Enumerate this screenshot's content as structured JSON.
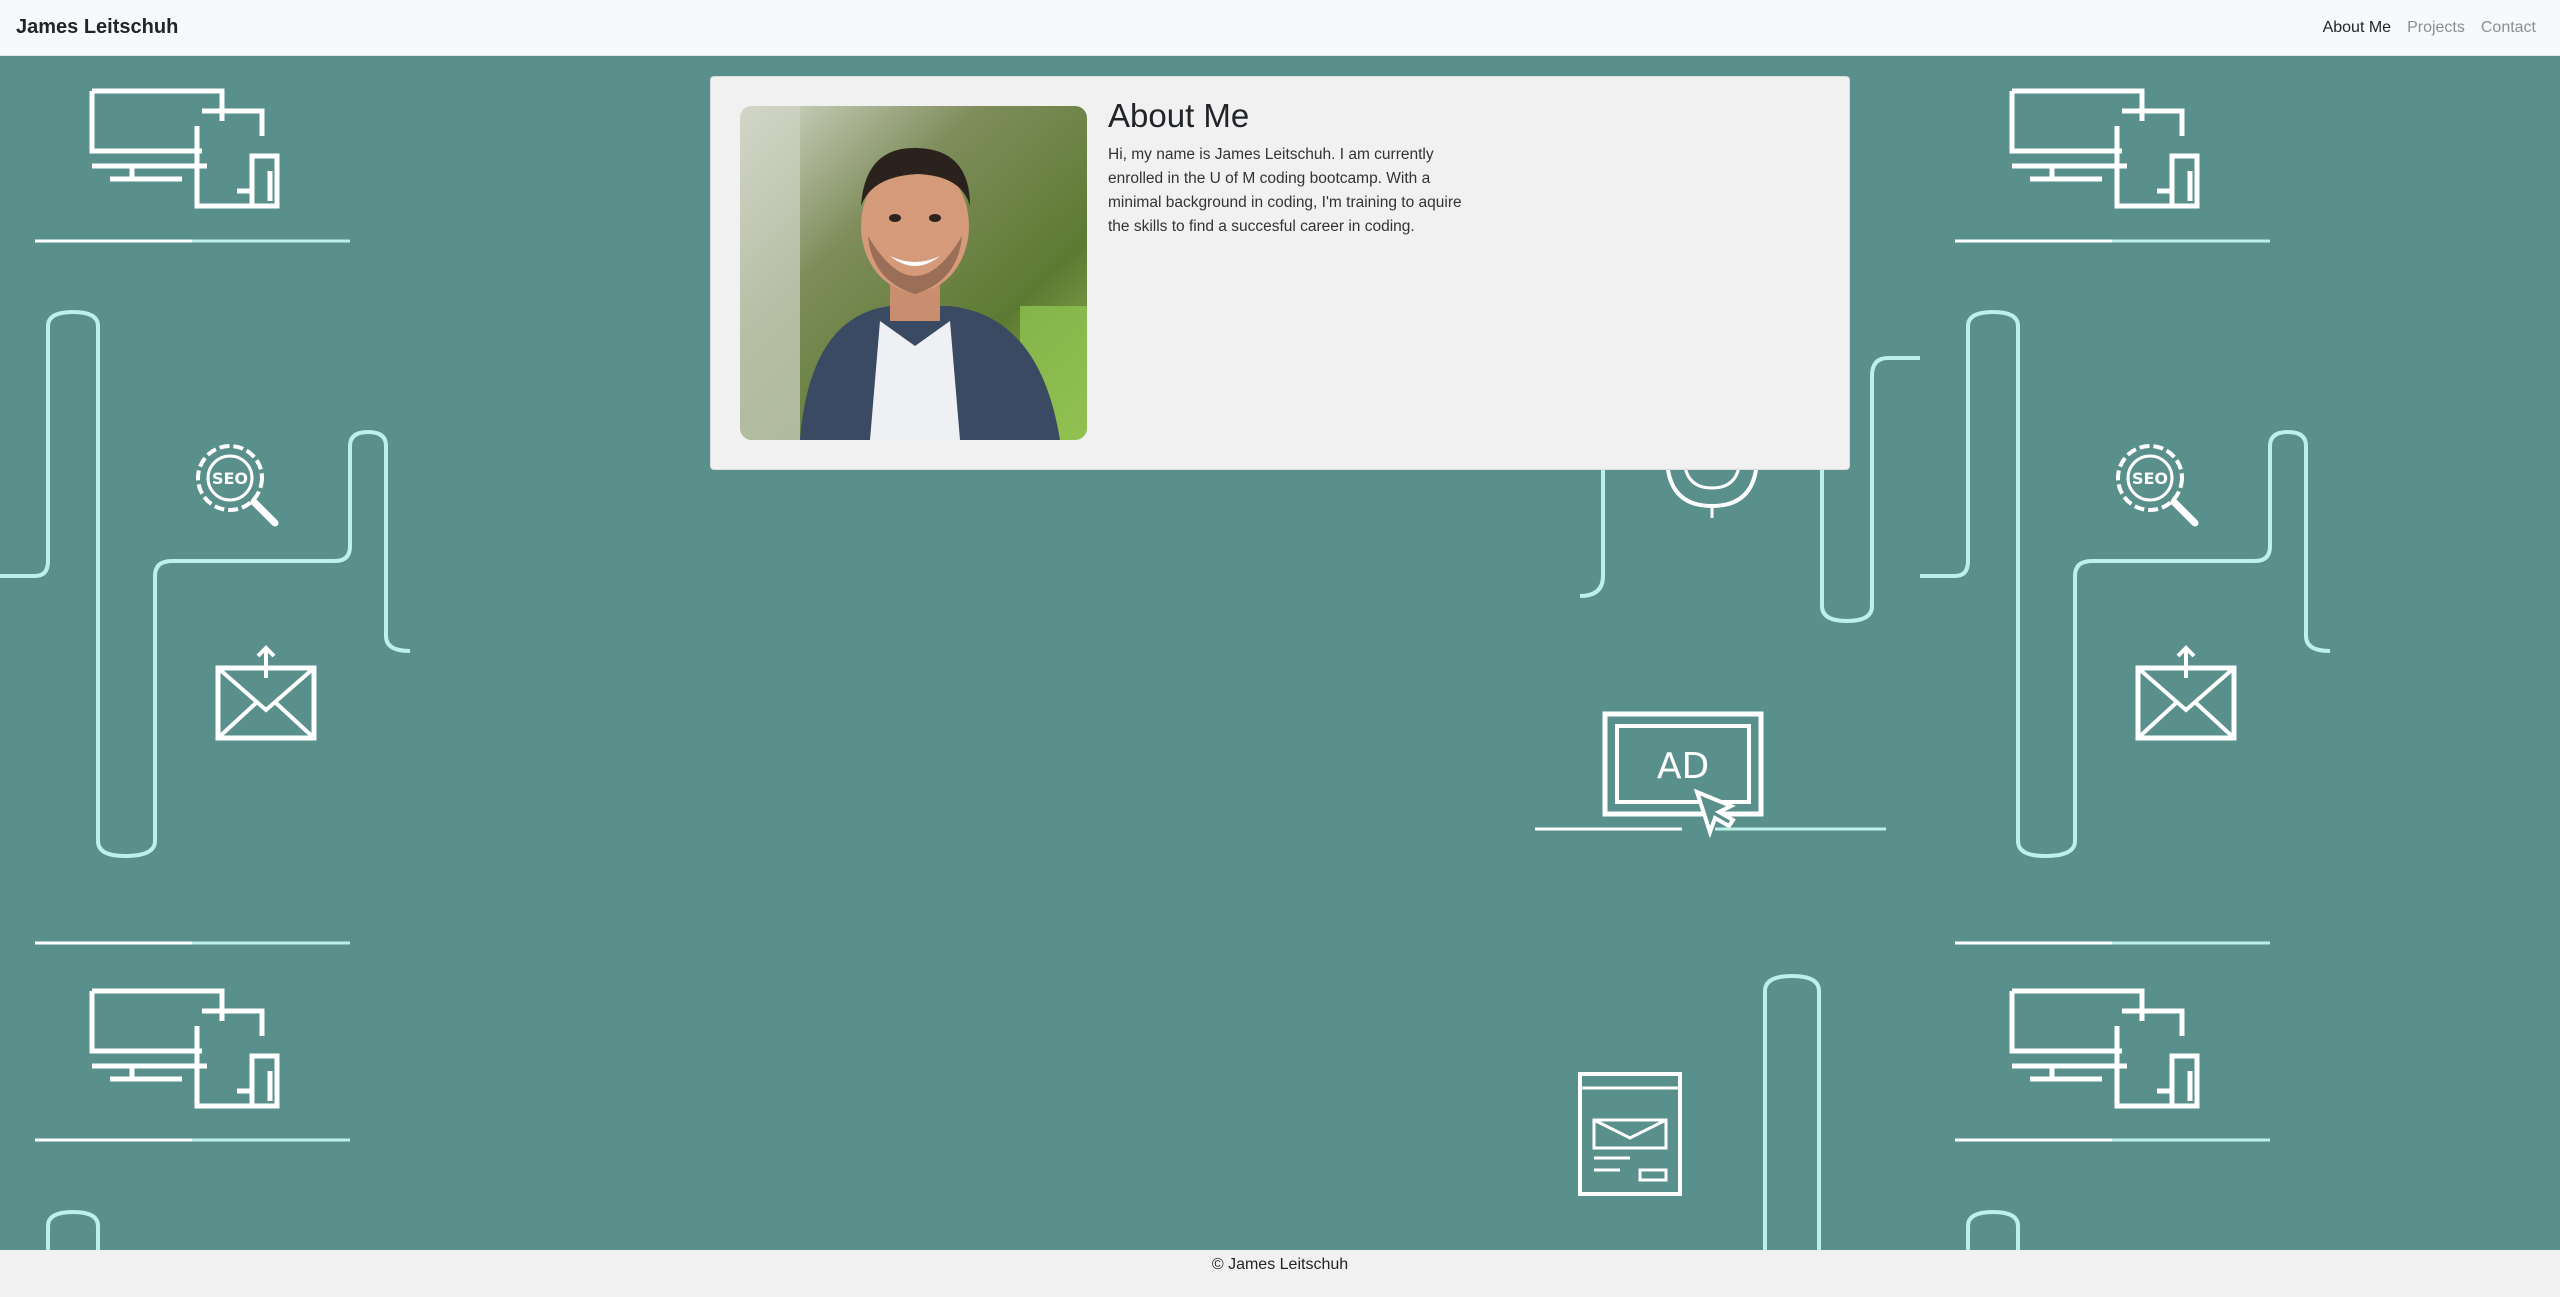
{
  "nav": {
    "brand": "James Leitschuh",
    "links": [
      {
        "label": "About Me",
        "active": true
      },
      {
        "label": "Projects",
        "active": false
      },
      {
        "label": "Contact",
        "active": false
      }
    ]
  },
  "about": {
    "title": "About Me",
    "text": "Hi, my name is James Leitschuh. I am currently enrolled in the U of M coding bootcamp. With a minimal background in coding, I'm training to aquire the skills to find a succesful career in coding.",
    "photo_icon": "profile-photo"
  },
  "background": {
    "color": "#5a908c",
    "line_color": "#bdf0ea",
    "icons": [
      "devices-icon",
      "seo-icon",
      "email-send-icon",
      "ad-click-icon",
      "newsletter-icon",
      "target-icon"
    ]
  },
  "footer": {
    "text": "© James Leitschuh"
  }
}
